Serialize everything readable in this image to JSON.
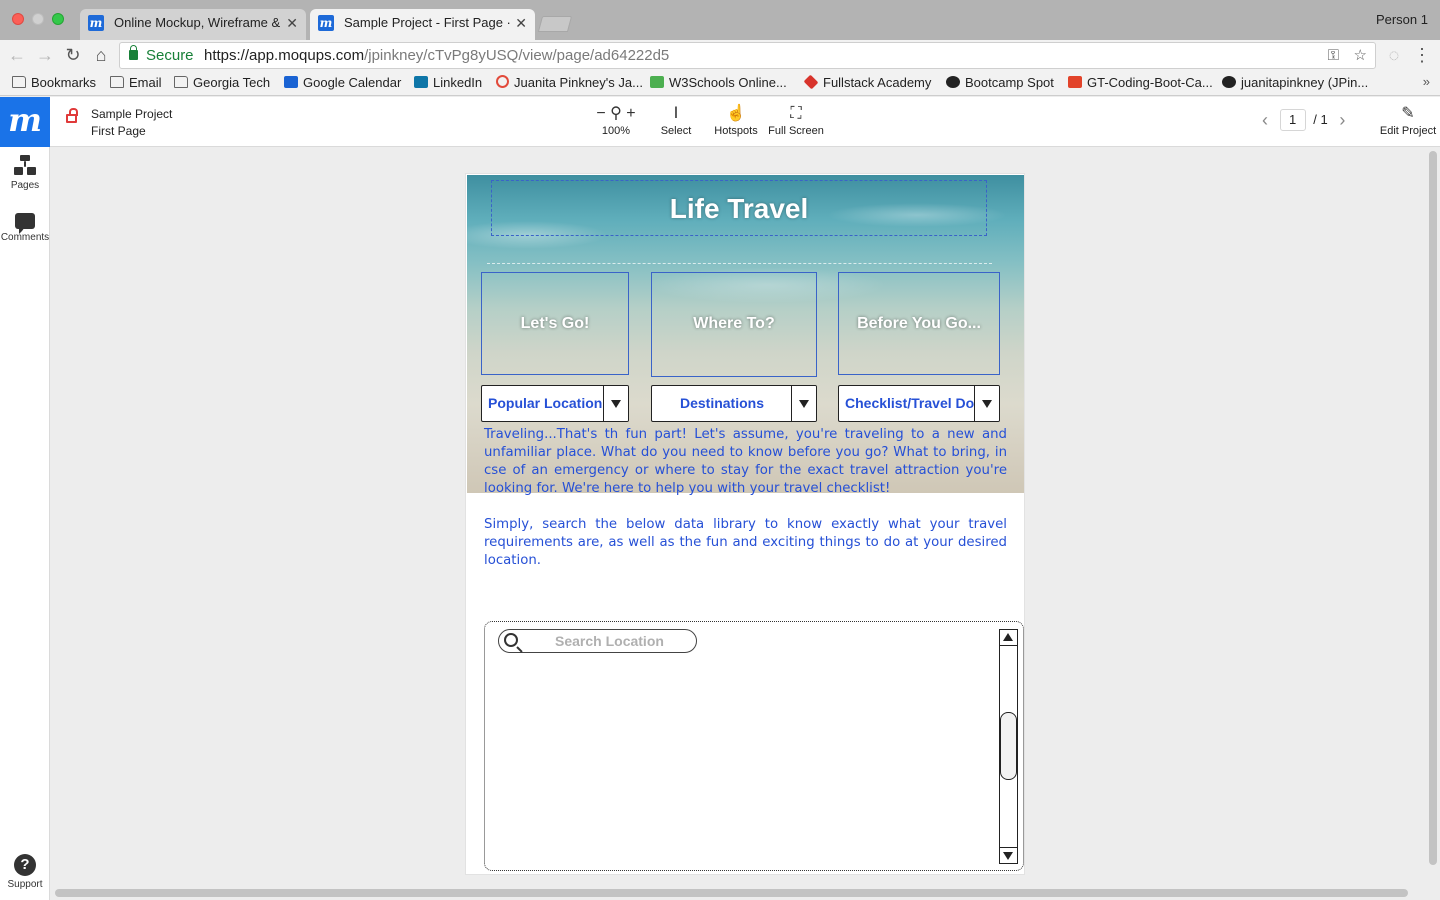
{
  "browser": {
    "person": "Person 1",
    "tabs": [
      {
        "title": "Online Mockup, Wireframe & UI",
        "active": false
      },
      {
        "title": "Sample Project - First Page · Moqups",
        "active": true
      }
    ],
    "omnibox": {
      "secure_label": "Secure",
      "url_host": "https://app.moqups.com",
      "url_path": "/jpinkney/cTvPg8yUSQ/view/page/ad64222d5"
    },
    "bookmarks": [
      {
        "label": "Bookmarks",
        "icon": "folder-icon"
      },
      {
        "label": "Email",
        "icon": "folder-icon"
      },
      {
        "label": "Georgia Tech",
        "icon": "folder-icon"
      },
      {
        "label": "Google Calendar",
        "icon": "calendar-icon"
      },
      {
        "label": "LinkedIn",
        "icon": "linkedin-icon"
      },
      {
        "label": "Juanita Pinkney's Ja...",
        "icon": "circle-icon"
      },
      {
        "label": "W3Schools Online...",
        "icon": "w3schools-icon"
      },
      {
        "label": "Fullstack Academy",
        "icon": "fullstack-icon"
      },
      {
        "label": "Bootcamp Spot",
        "icon": "github-icon"
      },
      {
        "label": "GT-Coding-Boot-Ca...",
        "icon": "gitlab-icon"
      },
      {
        "label": "juanitapinkney (JPin...",
        "icon": "github-icon"
      }
    ],
    "more": "»"
  },
  "app": {
    "logo": "m",
    "project_name": "Sample Project",
    "page_name": "First Page",
    "zoom": "100%",
    "tools": [
      {
        "label": "Select",
        "icon": "text-cursor-icon"
      },
      {
        "label": "Hotspots",
        "icon": "hand-pointer-icon"
      },
      {
        "label": "Full Screen",
        "icon": "fullscreen-icon"
      }
    ],
    "pager": {
      "current": "1",
      "total": "/ 1"
    },
    "edit_label": "Edit Project",
    "sidebar": [
      {
        "label": "Pages",
        "icon": "pages-icon"
      },
      {
        "label": "Comments",
        "icon": "comments-icon"
      }
    ],
    "support_label": "Support"
  },
  "mockup": {
    "title": "Life Travel",
    "cards": [
      "Let's Go!",
      "Where To?",
      "Before You Go..."
    ],
    "dropdowns": [
      "Popular Locations",
      "Destinations",
      "Checklist/Travel Docs"
    ],
    "paragraph1": "Traveling...That's th fun part! Let's assume, you're traveling to a new and unfamiliar place. What do you need to know before you go? What to bring, in cse of an emergency or where to stay for the exact travel attraction you're looking for. We're here to help you with your travel checklist!",
    "paragraph2": "Simply, search the below data library to know exactly what your travel requirements are, as well as the fun and exciting things to do at your desired location.",
    "search_placeholder": "Search Location",
    "colors": {
      "accent": "#2650d6",
      "brand": "#1a73e8",
      "box_border": "#3a63c8"
    }
  }
}
